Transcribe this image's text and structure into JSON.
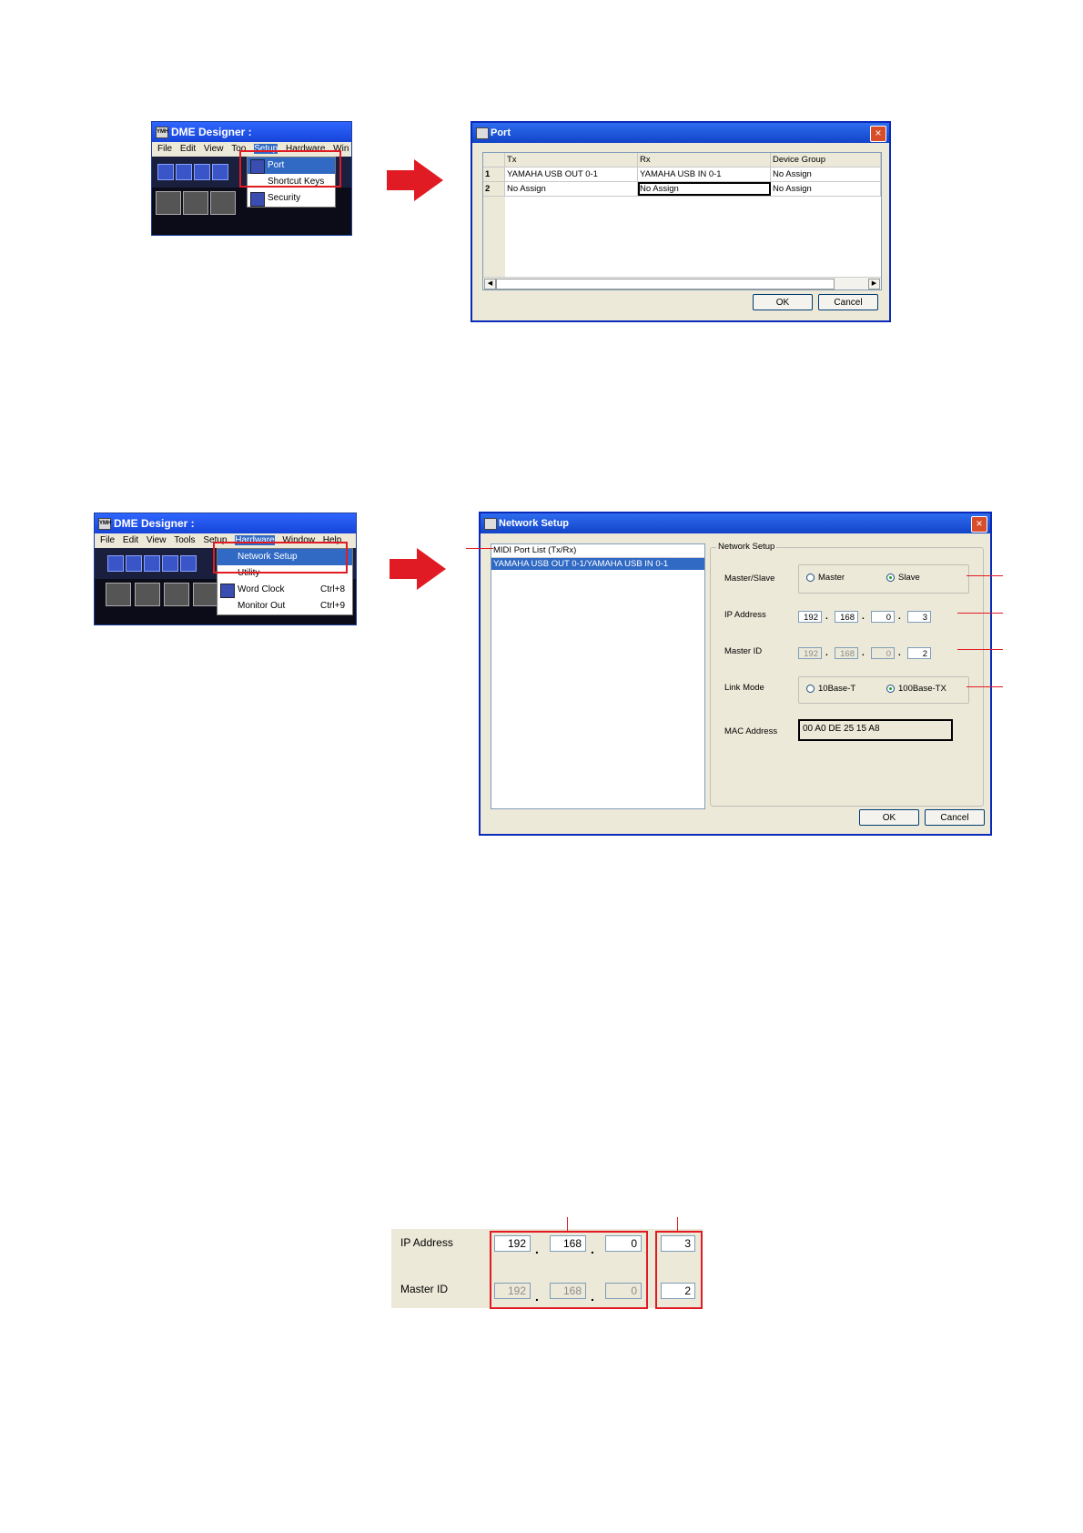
{
  "colors": {
    "accent_red": "#e01b24",
    "xp_blue": "#1644d8",
    "selection": "#316ac5",
    "dialog_bg": "#ece9d8"
  },
  "top_menu": {
    "window_title": "DME Designer :",
    "menubar": [
      "File",
      "Edit",
      "View",
      "Too",
      "Setup",
      "Hardware",
      "Win"
    ],
    "dropdown": [
      {
        "label": "Port",
        "icon": "port-icon"
      },
      {
        "label": "Shortcut Keys",
        "icon": ""
      },
      {
        "label": "Security",
        "icon": "security-icon"
      }
    ]
  },
  "port_dialog": {
    "title": "Port",
    "columns": [
      "Tx",
      "Rx",
      "Device Group"
    ],
    "rows": [
      {
        "num": "1",
        "tx": "YAMAHA USB OUT 0-1",
        "rx": "YAMAHA USB IN 0-1",
        "group": "No Assign"
      },
      {
        "num": "2",
        "tx": "No Assign",
        "rx": "No Assign",
        "group": "No Assign"
      }
    ],
    "ok": "OK",
    "cancel": "Cancel"
  },
  "net_menu": {
    "window_title": "DME Designer :",
    "menubar": [
      "File",
      "Edit",
      "View",
      "Tools",
      "Setup",
      "Hardware",
      "Window",
      "Help"
    ],
    "dropdown": [
      {
        "label": "Network Setup",
        "icon": "",
        "shortcut": ""
      },
      {
        "label": "Utility",
        "icon": "",
        "shortcut": ""
      },
      {
        "label": "Word Clock",
        "icon": "word-clock-icon",
        "shortcut": "Ctrl+8"
      },
      {
        "label": "Monitor Out",
        "icon": "",
        "shortcut": "Ctrl+9"
      }
    ]
  },
  "network_dialog": {
    "title": "Network Setup",
    "port_list_header": "MIDI Port List (Tx/Rx)",
    "port_list_item": "YAMAHA USB OUT 0-1/YAMAHA USB IN 0-1",
    "group_label": "Network Setup",
    "master_slave_label": "Master/Slave",
    "master_option": "Master",
    "slave_option": "Slave",
    "ip_label": "IP Address",
    "ip": [
      "192",
      "168",
      "0",
      "3"
    ],
    "master_id_label": "Master ID",
    "master_id": [
      "192",
      "168",
      "0",
      "2"
    ],
    "link_mode_label": "Link Mode",
    "link_10": "10Base-T",
    "link_100": "100Base-TX",
    "mac_label": "MAC Address",
    "mac": "00 A0 DE 25 15 A8",
    "ok": "OK",
    "cancel": "Cancel"
  },
  "zoom": {
    "ip_label": "IP Address",
    "ip": [
      "192",
      "168",
      "0",
      "3"
    ],
    "master_id_label": "Master ID",
    "master_id": [
      "192",
      "168",
      "0",
      "2"
    ]
  }
}
